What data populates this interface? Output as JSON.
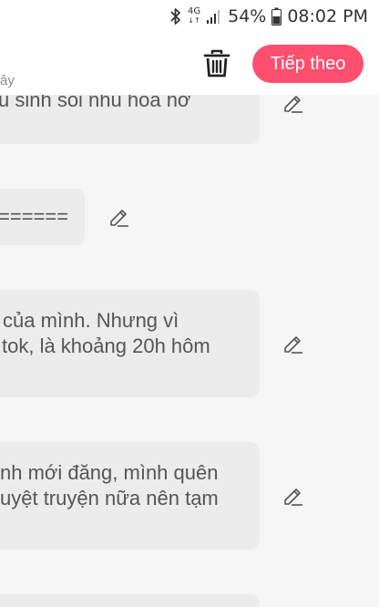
{
  "status_bar": {
    "network": "4G",
    "battery": "54%",
    "time": "08:02 PM"
  },
  "app_bar": {
    "subtitle_fragment": "ây",
    "next_label": "Tiếp theo"
  },
  "messages": [
    {
      "lines": [
        "u sinh sôi nhu hoa nở"
      ]
    },
    {
      "lines": [
        "======"
      ]
    },
    {
      "lines": [
        "của mình. Nhưng vì",
        "tok, là khoảng 20h hôm"
      ]
    },
    {
      "lines": [
        "nh mới đăng, mình quên",
        "uyệt truyện nữa nên tạm"
      ]
    },
    {
      "lines": []
    }
  ],
  "icons": {
    "bluetooth": "bluetooth-icon",
    "signal": "signal-icon",
    "battery": "battery-icon",
    "trash": "trash-icon",
    "edit": "pencil-icon"
  },
  "colors": {
    "accent": "#fe4f6e",
    "card": "#ececec",
    "background": "#f6f6f6"
  }
}
